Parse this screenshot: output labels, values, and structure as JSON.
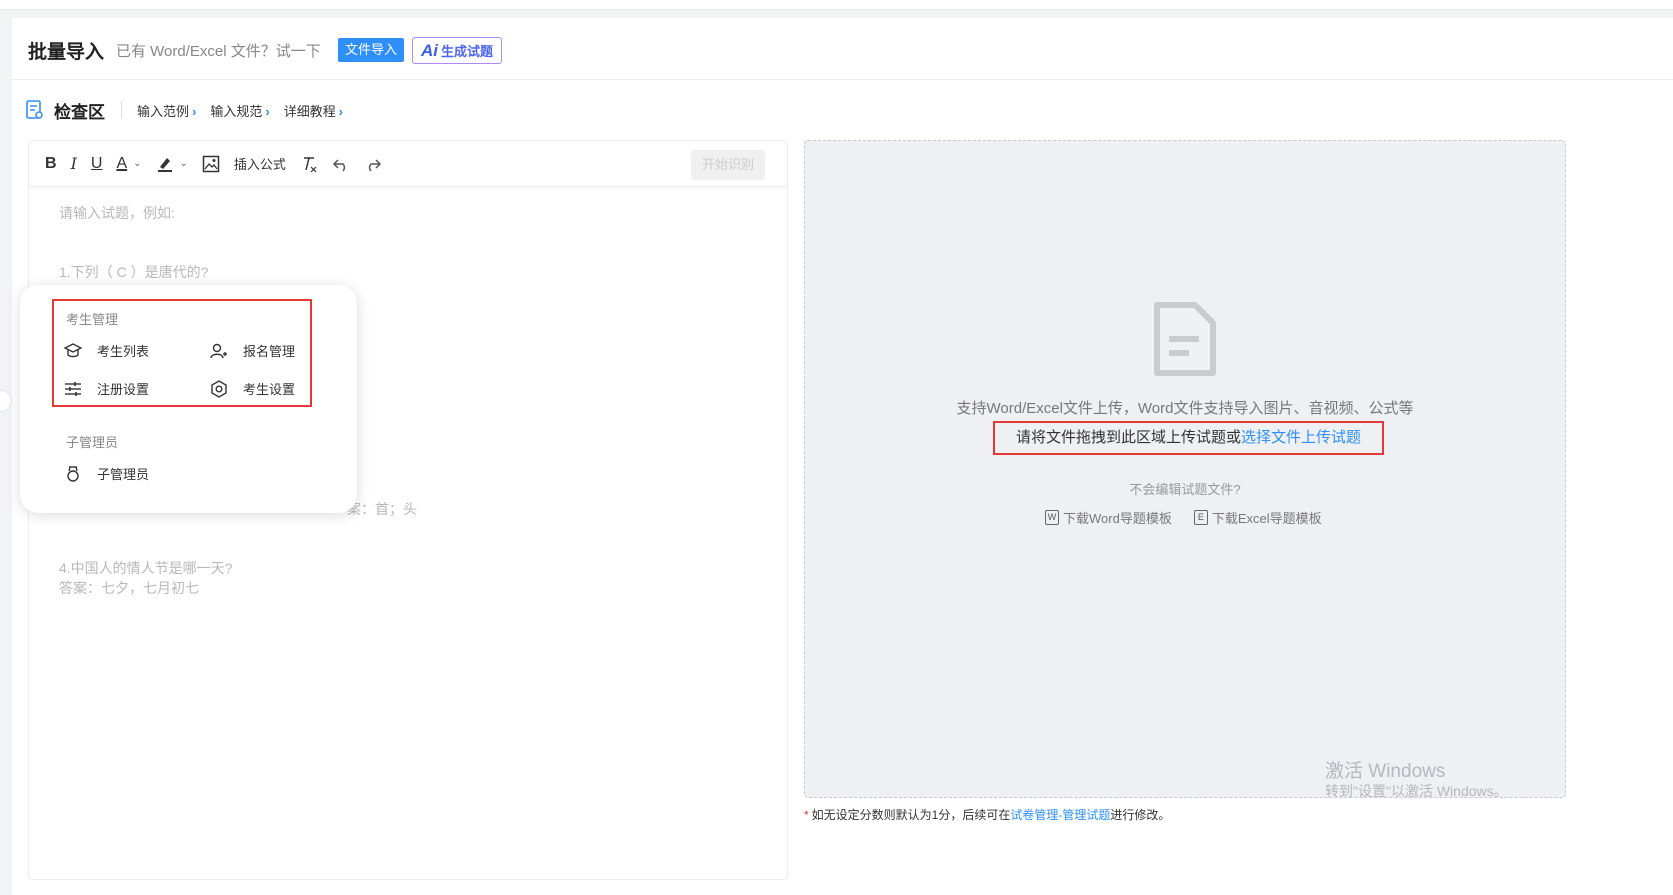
{
  "header": {
    "title": "批量导入",
    "subtitle": "已有 Word/Excel 文件？试一下",
    "import_button": "文件导入",
    "ai_icon": "Ai",
    "ai_button": "生成试题"
  },
  "check": {
    "label": "检查区",
    "links": [
      "输入范例",
      "输入规范",
      "详细教程"
    ],
    "chevron": "›"
  },
  "toolbar": {
    "bold": "B",
    "italic": "I",
    "underline": "U",
    "font_color": "A",
    "insert_formula": "插入公式",
    "start_button": "开始识别"
  },
  "editor": {
    "lines": [
      "请输入试题，例如:",
      "1.下列（ C ）是唐代的?",
      "案：首；头",
      "4.中国人的情人节是哪一天?",
      "答案：七夕，七月初七"
    ]
  },
  "popup": {
    "section1": "考生管理",
    "items1": [
      "考生列表",
      "报名管理",
      "注册设置",
      "考生设置"
    ],
    "section2": "子管理员",
    "items2": [
      "子管理员"
    ]
  },
  "dropzone": {
    "line1": "支持Word/Excel文件上传，Word文件支持导入图片、音视频、公式等",
    "line2_text": "请将文件拖拽到此区域上传试题或",
    "line2_link": "选择文件上传试题",
    "question": "不会编辑试题文件?",
    "word_badge": "W",
    "word_link": "下载Word导题模板",
    "excel_badge": "E",
    "excel_link": "下载Excel导题模板"
  },
  "footnote": {
    "star": "*",
    "text1": "如无设定分数则默认为1分，后续可在",
    "link": "试卷管理-管理试题",
    "text2": "进行修改。"
  },
  "watermark": {
    "line1": "激活 Windows",
    "line2": "转到\"设置\"以激活 Windows。"
  },
  "colors": {
    "accent": "#2f8ff8",
    "highlight_box": "#e53935",
    "ai_border": "#a98af6"
  }
}
